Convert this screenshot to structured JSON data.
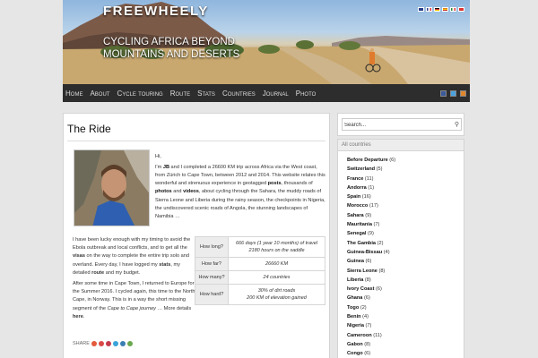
{
  "header": {
    "title": "FREEWHEELY",
    "tagline": "CYCLING AFRICA BEYOND MOUNTAINS AND DESERTS"
  },
  "language_flags": [
    "english-flag",
    "french-flag",
    "german-flag",
    "spanish-flag",
    "italian-flag",
    "swiss-flag"
  ],
  "nav": {
    "items": [
      "Home",
      "About",
      "Cycle touring",
      "Route",
      "Stats",
      "Countries",
      "Journal",
      "Photo"
    ],
    "icons": [
      "facebook-icon",
      "twitter-icon",
      "rss-icon"
    ]
  },
  "page": {
    "title": "The Ride",
    "greeting": "Hi,",
    "intro_parts": [
      "I'm ",
      "JB",
      " and I completed a 26600 KM trip across Africa via the West coast, from Zürich to Cape Town, between 2012 and 2014. This website relates this wonderful and strenuous experience in geotagged ",
      "posts",
      ", thousands of ",
      "photos",
      " and ",
      "videos",
      ", about cycling through the Sahara, the muddy roads of Sierra Leone and Liberia during the rainy season, the checkpoints in Nigeria, the undiscovered scenic roads of Angola, the stunning landscapes of Namibia …"
    ],
    "para1_parts": [
      "I have been lucky enough with my timing to avoid the Ebola outbreak and local conflicts, and to get all the ",
      "visas",
      " on the way to complete the entire trip solo and overland. Every day, I have logged my ",
      "stats",
      ", my detailed ",
      "route",
      " and my budget."
    ],
    "para2_parts": [
      "After some time in Cape Town, I returned to Europe for the Summer 2016. I cycled again, this time to the North Cape, in Norway. This is in a way the short missing segment of the ",
      "Cape to Cape journey",
      " … More details ",
      "here",
      "."
    ],
    "facts": [
      {
        "label": "How long?",
        "value": "666 days (1 year 10 months) of travel",
        "value2": "2180 hours on the saddle"
      },
      {
        "label": "How far?",
        "value": "26660 KM",
        "value2": ""
      },
      {
        "label": "How many?",
        "value": "24 countries",
        "value2": ""
      },
      {
        "label": "How hard?",
        "value": "30% of dirt roads",
        "value2": "200  KM of elevation gained"
      }
    ],
    "share_label": "SHARE",
    "share_buttons": [
      {
        "name": "share-facebook-icon",
        "color": "#e25b3a"
      },
      {
        "name": "share-google-icon",
        "color": "#d94a48"
      },
      {
        "name": "share-pinterest-icon",
        "color": "#c43b4d"
      },
      {
        "name": "share-twitter-icon",
        "color": "#3aa4d8"
      },
      {
        "name": "share-linkedin-icon",
        "color": "#3a7fb4"
      },
      {
        "name": "share-email-icon",
        "color": "#6aa84f"
      }
    ]
  },
  "sidebar": {
    "search_placeholder": "Search...",
    "countries_heading": "All countries",
    "countries": [
      {
        "name": "Before Departure",
        "count": "(6)"
      },
      {
        "name": "Switzerland",
        "count": "(5)"
      },
      {
        "name": "France",
        "count": "(11)"
      },
      {
        "name": "Andorra",
        "count": "(1)"
      },
      {
        "name": "Spain",
        "count": "(16)"
      },
      {
        "name": "Morocco",
        "count": "(17)"
      },
      {
        "name": "Sahara",
        "count": "(9)"
      },
      {
        "name": "Mauritania",
        "count": "(7)"
      },
      {
        "name": "Senegal",
        "count": "(9)"
      },
      {
        "name": "The Gambia",
        "count": "(2)"
      },
      {
        "name": "Guinea-Bissau",
        "count": "(4)"
      },
      {
        "name": "Guinea",
        "count": "(6)"
      },
      {
        "name": "Sierra Leone",
        "count": "(8)"
      },
      {
        "name": "Liberia",
        "count": "(8)"
      },
      {
        "name": "Ivory Coast",
        "count": "(6)"
      },
      {
        "name": "Ghana",
        "count": "(6)"
      },
      {
        "name": "Togo",
        "count": "(2)"
      },
      {
        "name": "Benin",
        "count": "(4)"
      },
      {
        "name": "Nigeria",
        "count": "(7)"
      },
      {
        "name": "Cameroon",
        "count": "(11)"
      },
      {
        "name": "Gabon",
        "count": "(8)"
      },
      {
        "name": "Congo",
        "count": "(6)"
      }
    ]
  }
}
